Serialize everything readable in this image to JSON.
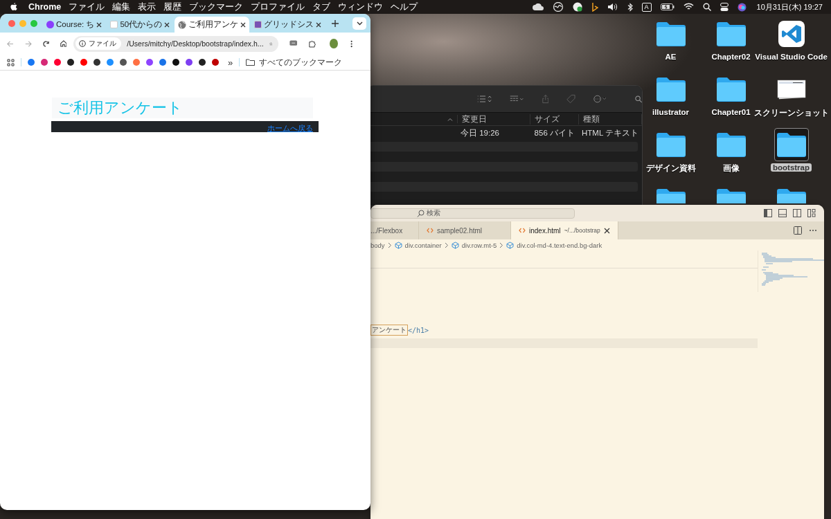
{
  "menubar": {
    "app_name": "Chrome",
    "menus": [
      "ファイル",
      "編集",
      "表示",
      "履歴",
      "ブックマーク",
      "プロファイル",
      "タブ",
      "ウィンドウ",
      "ヘルプ"
    ],
    "input_indicator": "A",
    "clock": "10月31日(木)  19:27"
  },
  "desktop_icons": [
    {
      "kind": "folder",
      "label": "AE",
      "selected": false
    },
    {
      "kind": "folder",
      "label": "Chapter02",
      "selected": false
    },
    {
      "kind": "app",
      "label": "Visual Studio Code",
      "selected": false
    },
    {
      "kind": "folder",
      "label": "illustrator",
      "selected": false
    },
    {
      "kind": "folder",
      "label": "Chapter01",
      "selected": false
    },
    {
      "kind": "screenshot",
      "label": "スクリーンショット",
      "selected": false
    },
    {
      "kind": "folder",
      "label": "デザイン資料",
      "selected": false
    },
    {
      "kind": "folder",
      "label": "画像",
      "selected": false
    },
    {
      "kind": "folder",
      "label": "bootstrap",
      "selected": true
    },
    {
      "kind": "folder",
      "selected": false
    },
    {
      "kind": "folder",
      "selected": false
    },
    {
      "kind": "folder",
      "selected": false
    }
  ],
  "finder_window": {
    "columns": [
      "変更日",
      "サイズ",
      "種類"
    ],
    "rows": [
      {
        "modified": "今日 19:26",
        "size": "856 バイト",
        "type": "HTML テキスト"
      }
    ]
  },
  "vscode_window": {
    "search_placeholder": "検索",
    "tabs": [
      {
        "label": ".../Flexbox",
        "selected": false
      },
      {
        "label": "sample02.html",
        "selected": false
      },
      {
        "label": "index.html",
        "description": "~/.../bootstrap",
        "selected": true
      }
    ],
    "breadcrumbs": [
      "body",
      "div.container",
      "div.row.mt-5",
      "div.col-md-4.text-end.bg-dark"
    ],
    "code_line": {
      "text": "アンケート",
      "tag": "</h1>"
    }
  },
  "browser_window": {
    "tabs": [
      {
        "title": "Course: ち",
        "selected": false
      },
      {
        "title": "50代からの",
        "selected": false
      },
      {
        "title": "ご利用アンケ",
        "selected": true
      },
      {
        "title": "グリッドシス",
        "selected": false
      }
    ],
    "address": {
      "badge": "ファイル",
      "url": "/Users/mitchy/Desktop/bootstrap/index.h..."
    },
    "bookmarks_overflow": "»",
    "bookmarks_folder": "すべてのブックマーク",
    "page": {
      "heading": "ご利用アンケート",
      "link": "ホームへ戻る"
    }
  }
}
